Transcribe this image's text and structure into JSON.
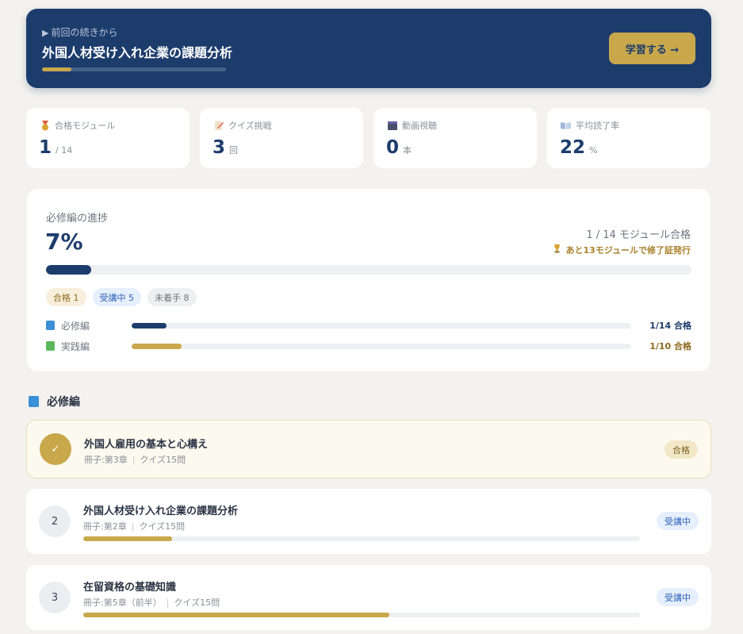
{
  "resume": {
    "label": "前回の続きから",
    "title": "外国人材受け入れ企業の課題分析",
    "progress": 0.16,
    "button": "学習する →"
  },
  "stats": [
    {
      "icon": "medal-icon",
      "label": "合格モジュール",
      "value": "1",
      "unit": "/ 14"
    },
    {
      "icon": "memo-icon",
      "label": "クイズ挑戦",
      "value": "3",
      "unit": "回"
    },
    {
      "icon": "clapper-icon",
      "label": "動画視聴",
      "value": "0",
      "unit": "本"
    },
    {
      "icon": "book-icon",
      "label": "平均読了率",
      "value": "22",
      "unit": "%"
    }
  ],
  "progress": {
    "label": "必修編の進捗",
    "percent": "7%",
    "fraction": 0.07,
    "count": "1 / 14 モジュール合格",
    "cert": "あと13モジュールで修了証発行",
    "chips": {
      "pass": "合格 1",
      "active": "受講中 5",
      "todo": "未着手 8"
    },
    "tracks": [
      {
        "name": "必修編",
        "result": "1/14 合格",
        "fraction": 0.07,
        "color": "#1c3c6c"
      },
      {
        "name": "実践編",
        "result": "1/10 合格",
        "fraction": 0.1,
        "color": "#c8a84b"
      }
    ]
  },
  "section": {
    "title": "必修編"
  },
  "modules": [
    {
      "marker": "✓",
      "title": "外国人雇用の基本と心構え",
      "chapter": "冊子:第3章",
      "quiz": "クイズ15問",
      "badge": "合格",
      "status": "passed"
    },
    {
      "marker": "2",
      "title": "外国人材受け入れ企業の課題分析",
      "chapter": "冊子:第2章",
      "quiz": "クイズ15問",
      "badge": "受講中",
      "status": "active",
      "progress": 0.16
    },
    {
      "marker": "3",
      "title": "在留資格の基礎知識",
      "chapter": "冊子:第5章（前半）",
      "quiz": "クイズ15問",
      "badge": "受講中",
      "status": "active",
      "progress": 0.55
    }
  ],
  "colors": {
    "navy": "#1c3c6c",
    "gold": "#c8a84b",
    "background": "#f3f2ef"
  }
}
